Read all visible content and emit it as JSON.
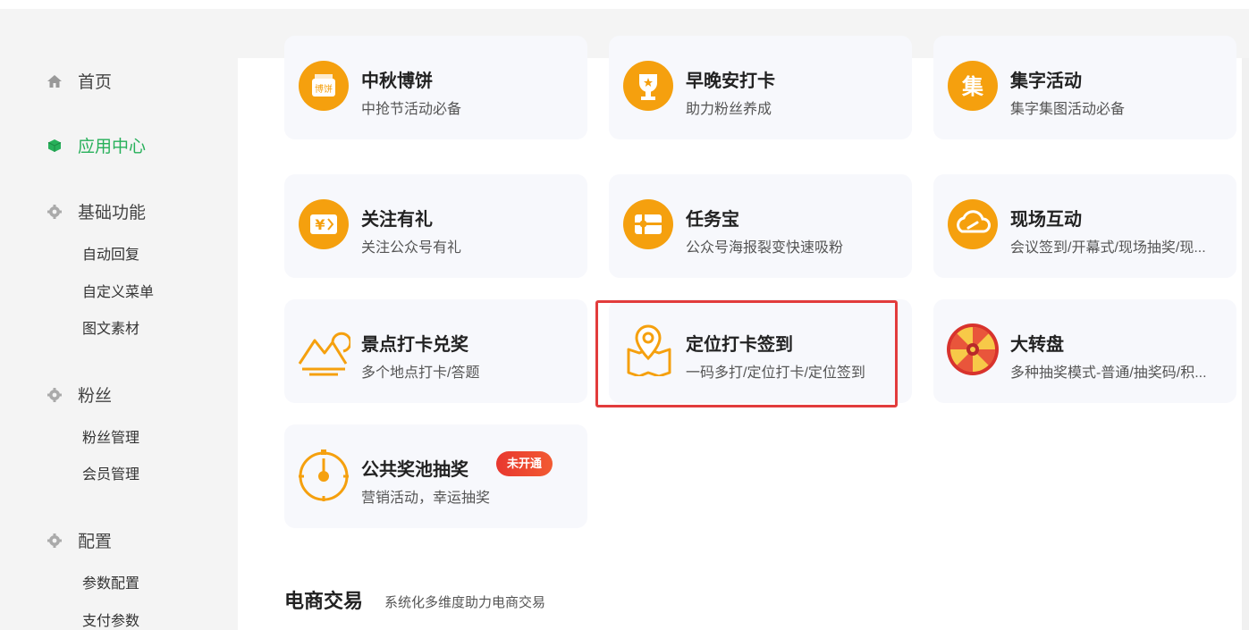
{
  "sidebar": {
    "groups": [
      {
        "label": "首页",
        "icon": "home-icon"
      },
      {
        "label": "应用中心",
        "icon": "cube-icon"
      },
      {
        "label": "基础功能",
        "icon": "gear-icon",
        "items": [
          "自动回复",
          "自定义菜单",
          "图文素材"
        ]
      },
      {
        "label": "粉丝",
        "icon": "gear-icon",
        "items": [
          "粉丝管理",
          "会员管理"
        ]
      },
      {
        "label": "配置",
        "icon": "gear-icon",
        "items": [
          "参数配置",
          "支付参数"
        ]
      }
    ]
  },
  "apps": [
    {
      "title": "中秋博饼",
      "desc": "中抢节活动必备",
      "icon": "mooncake-icon"
    },
    {
      "title": "早晚安打卡",
      "desc": "助力粉丝养成",
      "icon": "trophy-icon"
    },
    {
      "title": "集字活动",
      "desc": "集字集图活动必备",
      "icon": "collect-word-icon",
      "icon_text": "集"
    },
    {
      "title": "关注有礼",
      "desc": "关注公众号有礼",
      "icon": "coupon-icon",
      "icon_text": "¥"
    },
    {
      "title": "任务宝",
      "desc": "公众号海报裂变快速吸粉",
      "icon": "gift-card-icon"
    },
    {
      "title": "现场互动",
      "desc": "会议签到/开幕式/现场抽奖/现...",
      "icon": "cloud-link-icon"
    },
    {
      "title": "景点打卡兑奖",
      "desc": "多个地点打卡/答题",
      "icon": "mountain-icon"
    },
    {
      "title": "定位打卡签到",
      "desc": "一码多打/定位打卡/定位签到",
      "icon": "map-pin-icon"
    },
    {
      "title": "大转盘",
      "desc": "多种抽奖模式-普通/抽奖码/积...",
      "icon": "prize-wheel-icon"
    },
    {
      "title": "公共奖池抽奖",
      "desc": "营销活动，幸运抽奖",
      "icon": "target-icon",
      "badge": "未开通"
    }
  ],
  "section": {
    "title": "电商交易",
    "subtitle": "系统化多维度助力电商交易"
  },
  "colors": {
    "accent": "#27b05a",
    "icon_orange": "#f5a00e",
    "highlight": "#e23c3c",
    "badge": "#e8382f"
  }
}
